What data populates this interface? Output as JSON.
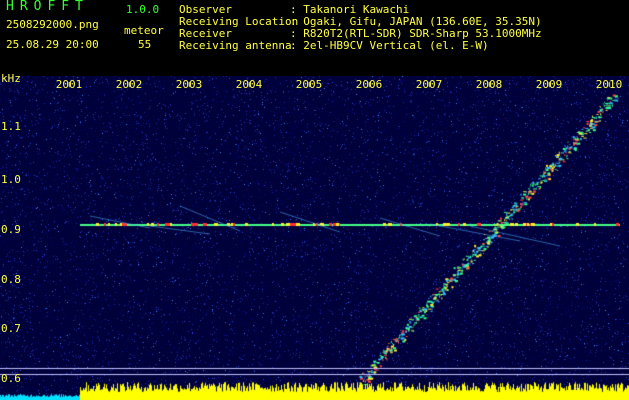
{
  "header": {
    "app_title": "HROFFT",
    "app_version": "1.0.0",
    "file_name": "2508292000.png",
    "timestamp": "25.08.29 20:00",
    "meteor_label": "meteor",
    "meteor_count": "55",
    "info": [
      {
        "label": "Observer",
        "value": ": Takanori Kawachi"
      },
      {
        "label": "Receiving Location",
        "value": ": Ogaki, Gifu, JAPAN (136.60E, 35.35N)"
      },
      {
        "label": "Receiver",
        "value": ": R820T2(RTL-SDR) SDR-Sharp 53.1000MHz"
      },
      {
        "label": "Receiving antenna",
        "value": ": 2el-HB9CV Vertical (el. E-W)"
      }
    ]
  },
  "spectrogram": {
    "y_unit": "kHz",
    "y_ticks": [
      "1.1",
      "1.0",
      "0.9",
      "0.8",
      "0.7",
      "0.6"
    ],
    "x_ticks": [
      "2001",
      "2002",
      "2003",
      "2004",
      "2005",
      "2006",
      "2007",
      "2008",
      "2009",
      "2010"
    ],
    "colors": {
      "background": "#00003a",
      "carrier": "#44ff88",
      "hot": "#ff3333",
      "text_green": "#33ff33",
      "text_yellow": "#ffff40",
      "noise_floor": "#ffff00",
      "noise_floor_low": "#00e0ff"
    }
  }
}
